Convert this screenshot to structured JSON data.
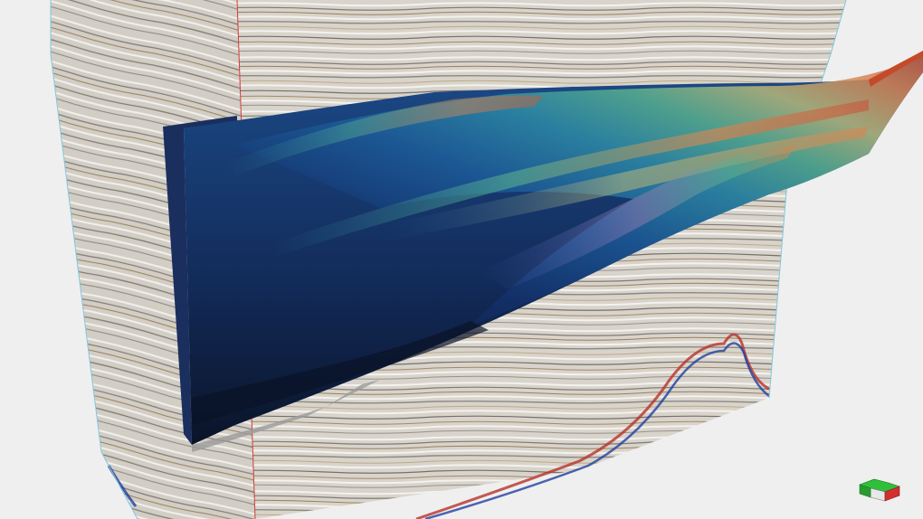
{
  "viewport": {
    "background": "#efefef",
    "edge_color": "#7fc8df",
    "inline_marker_color": "#d43c3c",
    "seismic": {
      "base": "#d8d4cc",
      "light": "#f4f2ee",
      "dark": "#5a5650",
      "brown": "#8a6a3a",
      "red": "#b8322a",
      "blue": "#2040a0"
    },
    "horizon_colormap": [
      "#0e1d3a",
      "#13306a",
      "#1c5a98",
      "#2d8aa6",
      "#58b08f",
      "#b6b87a",
      "#d68452",
      "#c45a3e"
    ]
  },
  "orientation_widget": {
    "top_color": "#2fbf3a",
    "side_color": "#d42f2f",
    "front_color": "#e8e8e8"
  }
}
